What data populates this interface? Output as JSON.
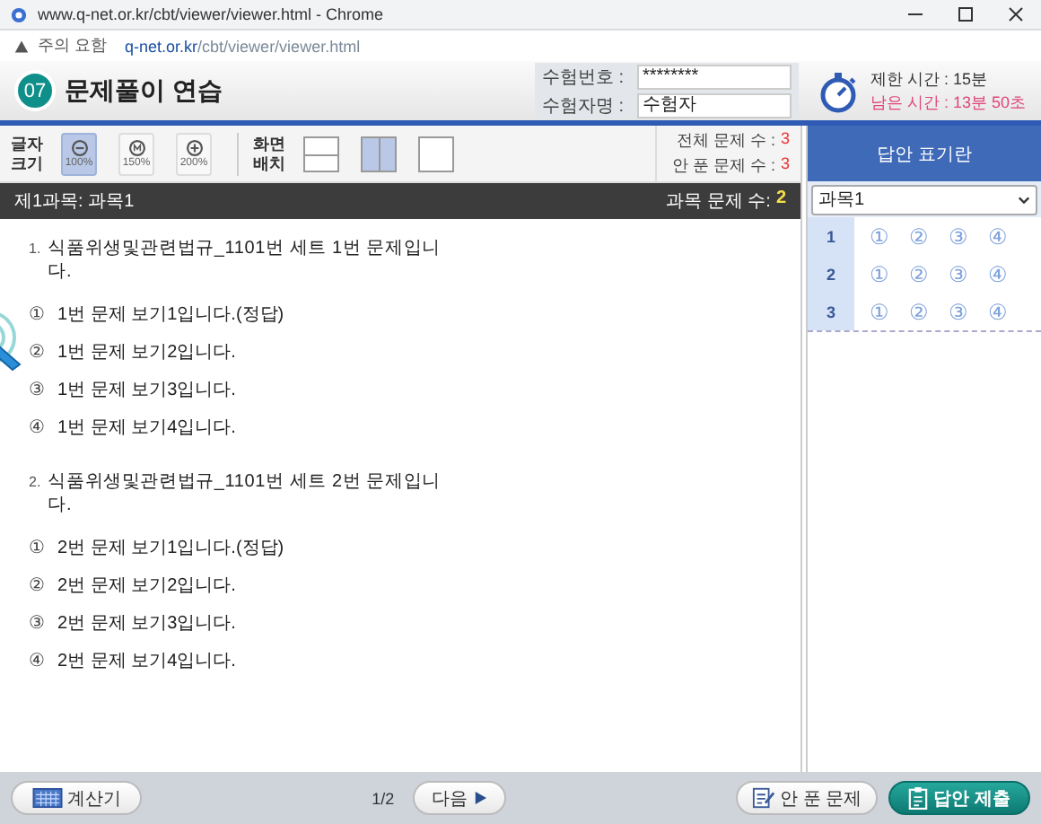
{
  "browser": {
    "title": "www.q-net.or.kr/cbt/viewer/viewer.html - Chrome",
    "warning": "주의 요함",
    "url_host": "q-net.or.kr",
    "url_path": "/cbt/viewer/viewer.html"
  },
  "header": {
    "badge": "07",
    "title": "문제풀이 연습",
    "fields": [
      {
        "label": "수험번호 :",
        "value": "********"
      },
      {
        "label": "수험자명 :",
        "value": "수험자"
      }
    ],
    "time_limit": "제한 시간 : 15분",
    "time_left": "남은 시간 : 13분 50초"
  },
  "toolbar": {
    "font_label": "글자 크기",
    "zoom": [
      {
        "kind": "minus",
        "label": "100%",
        "selected": true
      },
      {
        "kind": "mid",
        "label": "150%",
        "selected": false
      },
      {
        "kind": "plus",
        "label": "200%",
        "selected": false
      }
    ],
    "layout_label": "화면 배치",
    "layouts": [
      {
        "kind": "rows",
        "selected": false
      },
      {
        "kind": "columns",
        "selected": true
      },
      {
        "kind": "single",
        "selected": false
      }
    ],
    "counts": [
      {
        "label": "전체 문제 수 :",
        "value": "3"
      },
      {
        "label": "안 푼 문제 수 :",
        "value": "3"
      }
    ]
  },
  "subject_bar": {
    "title": "제1과목:  과목1",
    "count_label": "과목 문제 수:",
    "count": "2"
  },
  "questions": [
    {
      "number": "1.",
      "text": "식품위생및관련법규_1101번 세트 1번 문제입니다.",
      "options": [
        {
          "mark": "①",
          "text": "1번 문제 보기1입니다.(정답)"
        },
        {
          "mark": "②",
          "text": "1번 문제 보기2입니다."
        },
        {
          "mark": "③",
          "text": "1번 문제 보기3입니다."
        },
        {
          "mark": "④",
          "text": "1번 문제 보기4입니다."
        }
      ]
    },
    {
      "number": "2.",
      "text": "식품위생및관련법규_1101번 세트 2번 문제입니다.",
      "options": [
        {
          "mark": "①",
          "text": "2번 문제 보기1입니다.(정답)"
        },
        {
          "mark": "②",
          "text": "2번 문제 보기2입니다."
        },
        {
          "mark": "③",
          "text": "2번 문제 보기3입니다."
        },
        {
          "mark": "④",
          "text": "2번 문제 보기4입니다."
        }
      ]
    }
  ],
  "answer_panel": {
    "title": "답안 표기란",
    "subject": "과목1",
    "rows": [
      {
        "number": "1",
        "choices": [
          "①",
          "②",
          "③",
          "④"
        ]
      },
      {
        "number": "2",
        "choices": [
          "①",
          "②",
          "③",
          "④"
        ]
      },
      {
        "number": "3",
        "choices": [
          "①",
          "②",
          "③",
          "④"
        ]
      }
    ]
  },
  "footer": {
    "calculator": "계산기",
    "page": "1/2",
    "next": "다음",
    "unsolved": "안 푼 문제",
    "submit": "답안 제출"
  }
}
